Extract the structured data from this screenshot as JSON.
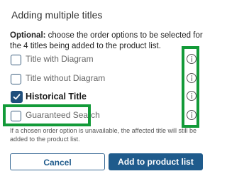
{
  "dialog": {
    "title": "Adding multiple titles",
    "intro_bold": "Optional:",
    "intro_text": " choose the order options to be selected for the 4 titles being added to the product list.",
    "options": [
      {
        "label": "Title with Diagram",
        "checked": false,
        "info_icon": "info-icon"
      },
      {
        "label": "Title without Diagram",
        "checked": false,
        "info_icon": "info-icon"
      },
      {
        "label": "Historical Title",
        "checked": true,
        "info_icon": "info-icon"
      },
      {
        "label": "Guaranteed Search",
        "checked": false,
        "info_icon": "info-icon"
      }
    ],
    "note": "If a chosen order option is unavailable, the affected title will still be added to the product list.",
    "cancel_label": "Cancel",
    "add_label": "Add to product list"
  },
  "colors": {
    "primary": "#1f5b8c",
    "highlight": "#129a38"
  }
}
